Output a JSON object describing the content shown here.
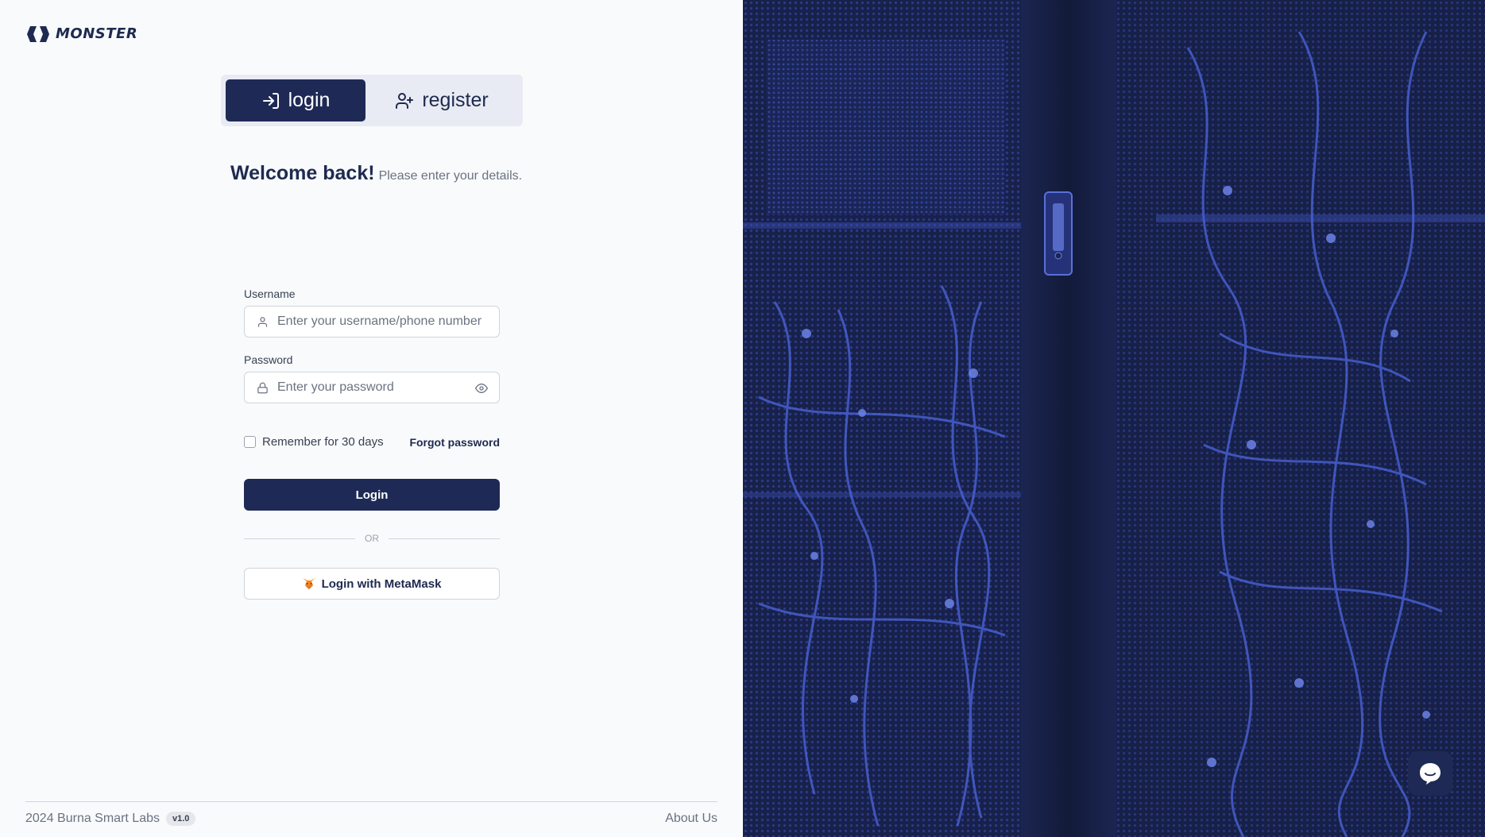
{
  "logo": {
    "text": "MONSTER",
    "icon": "monster-logo-icon"
  },
  "tabs": [
    {
      "label": "login",
      "icon": "login-icon",
      "active": true
    },
    {
      "label": "register",
      "icon": "user-plus-icon",
      "active": false
    }
  ],
  "welcome": {
    "title": "Welcome back!",
    "subtitle": "Please enter your details."
  },
  "form": {
    "username": {
      "label": "Username",
      "placeholder": "Enter your username/phone number",
      "value": "",
      "icon": "user-icon"
    },
    "password": {
      "label": "Password",
      "placeholder": "Enter your password",
      "value": "",
      "icon": "lock-icon",
      "toggle_icon": "eye-icon"
    },
    "remember_label": "Remember for 30 days",
    "remember_checked": false,
    "forgot_label": "Forgot password",
    "login_label": "Login",
    "or_label": "OR",
    "metamask_label": "Login with MetaMask",
    "metamask_icon": "fox-icon"
  },
  "footer": {
    "copyright": "2024 Burna Smart Labs",
    "version": "v1.0",
    "about": "About Us"
  },
  "chat": {
    "icon": "chat-bubble-icon"
  },
  "colors": {
    "primary": "#1e2a55",
    "accent_blue": "#4a5fd1",
    "hero_bg": "#141b34",
    "page_bg": "#f8fafc"
  }
}
